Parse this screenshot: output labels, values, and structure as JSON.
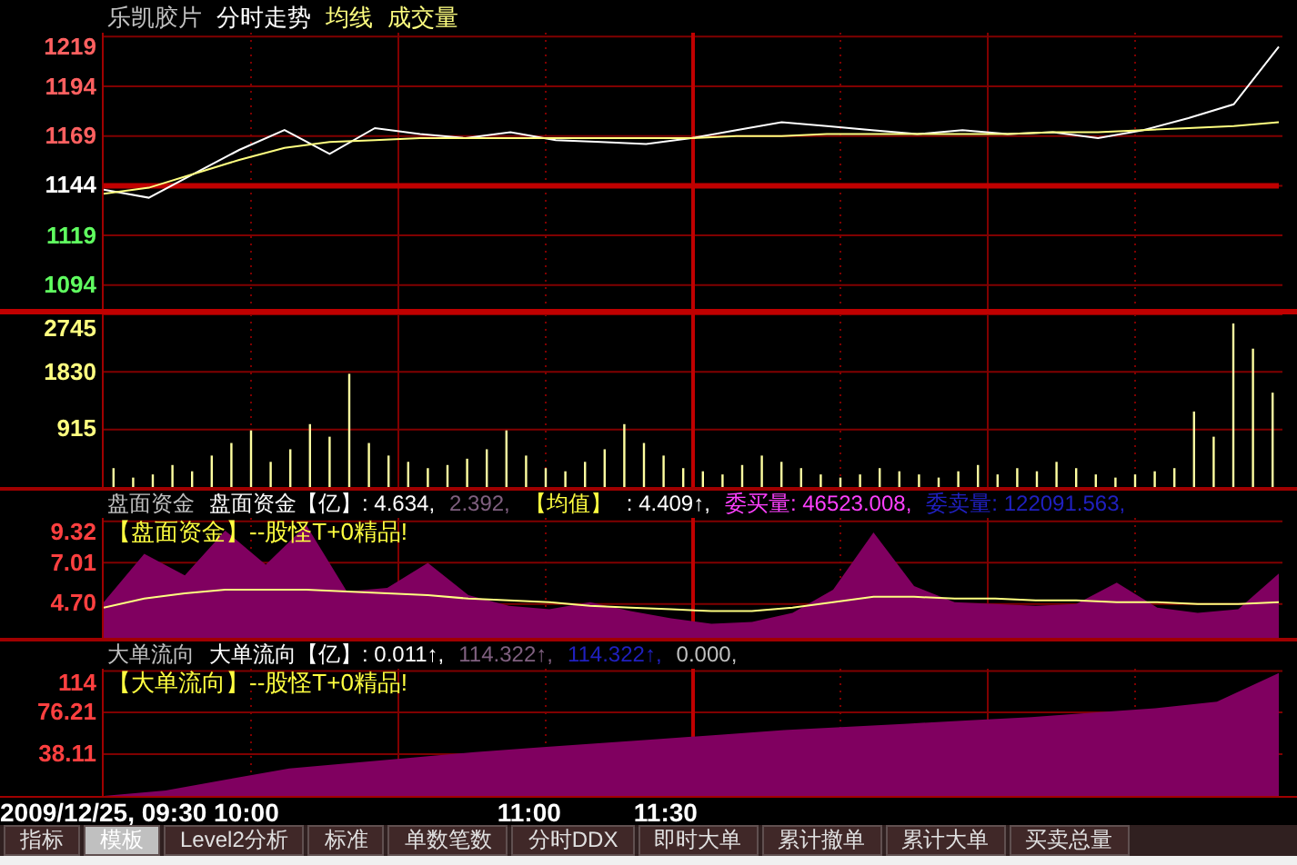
{
  "price_panel": {
    "header": [
      {
        "text": "乐凯胶片",
        "color": "#c0c0c0"
      },
      {
        "text": "分时走势",
        "color": "#ffffff"
      },
      {
        "text": "均线",
        "color": "#ffff80"
      },
      {
        "text": "成交量",
        "color": "#ffff80"
      }
    ],
    "chart_data": {
      "type": "line",
      "ylim": [
        1082,
        1221
      ],
      "yticks": [
        1094,
        1119,
        1144,
        1169,
        1194,
        1219
      ],
      "grid": true,
      "series": [
        {
          "color": "#c00000",
          "values": [
            1144,
            1144,
            1144,
            1144,
            1144,
            1144,
            1144,
            1144,
            1144,
            1144,
            1144,
            1144,
            1144,
            1144,
            1144,
            1144,
            1144,
            1144,
            1144,
            1144,
            1144,
            1144,
            1144,
            1144,
            1144,
            1144,
            1144
          ]
        },
        {
          "color": "#ffffff",
          "values": [
            1142,
            1138,
            1150,
            1162,
            1172,
            1160,
            1173,
            1170,
            1168,
            1171,
            1167,
            1166,
            1165,
            1168,
            1172,
            1176,
            1174,
            1172,
            1170,
            1172,
            1170,
            1171,
            1168,
            1172,
            1178,
            1185,
            1214
          ]
        },
        {
          "color": "#ffff80",
          "values": [
            1140,
            1143,
            1150,
            1157,
            1163,
            1166,
            1167,
            1168,
            1168,
            1168,
            1168,
            1168,
            1168,
            1168,
            1169,
            1169,
            1170,
            1170,
            1170,
            1170,
            1170,
            1171,
            1171,
            1172,
            1173,
            1174,
            1176
          ]
        }
      ]
    }
  },
  "volume_panel": {
    "chart_data": {
      "type": "bar",
      "ylim": [
        0,
        2745
      ],
      "yticks": [
        915,
        1830,
        2745
      ],
      "grid": true,
      "series": [
        {
          "color": "#ffffa0",
          "values": [
            300,
            150,
            200,
            350,
            250,
            500,
            700,
            900,
            400,
            600,
            1000,
            800,
            1800,
            700,
            500,
            400,
            300,
            350,
            450,
            600,
            900,
            500,
            300,
            250,
            400,
            600,
            1000,
            700,
            500,
            300,
            250,
            200,
            350,
            500,
            400,
            300,
            200,
            150,
            200,
            300,
            250,
            200,
            150,
            250,
            350,
            200,
            300,
            250,
            400,
            300,
            200,
            150,
            200,
            250,
            300,
            1200,
            800,
            2600,
            2200,
            1500
          ]
        }
      ]
    }
  },
  "funds_panel": {
    "header": [
      {
        "text": "盘面资金",
        "color": "#c0c0c0"
      },
      {
        "text": "盘面资金【亿】: 4.634,",
        "color": "#ffffff"
      },
      {
        "text": "2.392,",
        "color": "#806080"
      },
      {
        "text": "【均值】",
        "color": "#ffff40"
      },
      {
        "text": ": 4.409↑,",
        "color": "#ffffff"
      },
      {
        "text": "委买量: 46523.008,",
        "color": "#ff40ff"
      },
      {
        "text": "委卖量: 122091.563,",
        "color": "#2020c0"
      }
    ],
    "note": "【盘面资金】--股怪T+0精品!",
    "chart_data": {
      "type": "area",
      "grid": true,
      "ylim": [
        2.81,
        9.51
      ],
      "yticks": [
        {
          "value": 4.7,
          "label": "4.70"
        },
        7.01,
        9.32
      ],
      "series": [
        {
          "color": "#800060",
          "type": "area",
          "values": [
            4.8,
            7.5,
            6.3,
            8.8,
            6.9,
            9.1,
            5.4,
            5.6,
            7.0,
            5.2,
            4.6,
            4.4,
            4.8,
            4.3,
            3.9,
            3.6,
            3.7,
            4.2,
            5.5,
            8.7,
            5.7,
            4.8,
            4.7,
            4.6,
            4.7,
            5.9,
            4.5,
            4.2,
            4.4,
            6.4
          ]
        },
        {
          "color": "#ffff80",
          "type": "line",
          "values": [
            4.5,
            5.0,
            5.3,
            5.5,
            5.5,
            5.5,
            5.4,
            5.3,
            5.2,
            5.0,
            4.9,
            4.8,
            4.6,
            4.5,
            4.4,
            4.3,
            4.3,
            4.5,
            4.8,
            5.1,
            5.1,
            5.0,
            5.0,
            4.9,
            4.9,
            4.8,
            4.8,
            4.7,
            4.7,
            4.8
          ]
        }
      ]
    }
  },
  "flow_panel": {
    "header": [
      {
        "text": "大单流向",
        "kind": "name"
      },
      {
        "text": "大单流向【亿】: 0.011↑,",
        "kind": "value"
      },
      {
        "text": "114.322↑,",
        "kind": "dim"
      },
      {
        "text": "114.322↑,",
        "kind": "blue"
      },
      {
        "text": "0.000,",
        "kind": "name"
      }
    ],
    "note": "【大单流向】--股怪T+0精品!",
    "chart_data": {
      "type": "area",
      "grid": true,
      "ylim": [
        0,
        116
      ],
      "yticks": [
        38.11,
        76.21,
        114
      ],
      "series": [
        {
          "color": "#800060",
          "type": "area",
          "values": [
            0,
            5,
            15,
            25,
            30,
            35,
            40,
            44,
            48,
            52,
            56,
            60,
            63,
            66,
            69,
            72,
            76,
            80,
            86,
            112
          ]
        }
      ]
    }
  },
  "time_axis": [
    "2009/12/25, 09:30 10:00",
    "11:00",
    "11:30"
  ],
  "tabs": [
    {
      "label": "指标",
      "selected": false
    },
    {
      "label": "模板",
      "selected": true
    },
    {
      "label": "Level2分析",
      "selected": false
    },
    {
      "label": "标准",
      "selected": false
    },
    {
      "label": "单数笔数",
      "selected": false
    },
    {
      "label": "分时DDX",
      "selected": false
    },
    {
      "label": "即时大单",
      "selected": false
    },
    {
      "label": "累计撤单",
      "selected": false
    },
    {
      "label": "累计大单",
      "selected": false
    },
    {
      "label": "买卖总量",
      "selected": false
    }
  ]
}
